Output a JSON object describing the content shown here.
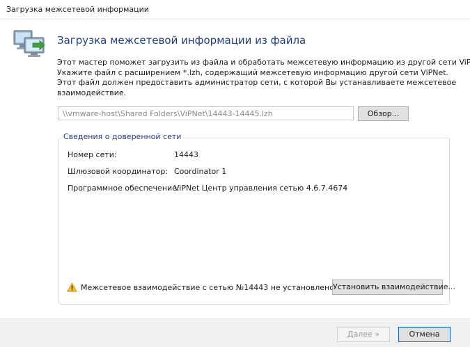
{
  "window": {
    "title": "Загрузка межсетевой информации"
  },
  "header": {
    "icon": "network-computers-icon",
    "title": "Загрузка межсетевой информации из файла"
  },
  "description": {
    "lines": [
      "Этот мастер поможет загрузить из файла и обработать межсетевую информацию из другой сети ViPNet.",
      "Укажите файл с расширением *.lzh, содержащий межсетевую информацию другой сети ViPNet.",
      "Этот файл должен предоставить администратор сети, с которой Вы устанавливаете межсетевое",
      "взаимодействие."
    ]
  },
  "file": {
    "path": "\\\\vmware-host\\Shared Folders\\ViPNet\\14443-14445.lzh",
    "browse_label": "Обзор..."
  },
  "trusted_network": {
    "legend": "Сведения о доверенной сети",
    "rows": [
      {
        "label": "Номер сети:",
        "value": "14443"
      },
      {
        "label": "Шлюзовой координатор:",
        "value": "Coordinator 1"
      },
      {
        "label": "Программное обеспечение:",
        "value": "ViPNet Центр управления сетью 4.6.7.4674"
      }
    ],
    "warning_icon": "warning-triangle-icon",
    "warning_text": "Межсетевое взаимодействие с сетью №14443 не установлено.",
    "connect_label": "Установить взаимодействие..."
  },
  "footer": {
    "next_label": "Далее »",
    "next_enabled": false,
    "cancel_label": "Отмена"
  },
  "colors": {
    "accent": "#1c3e92",
    "warning": "#f2c029",
    "focus_border": "#0a64c8"
  }
}
